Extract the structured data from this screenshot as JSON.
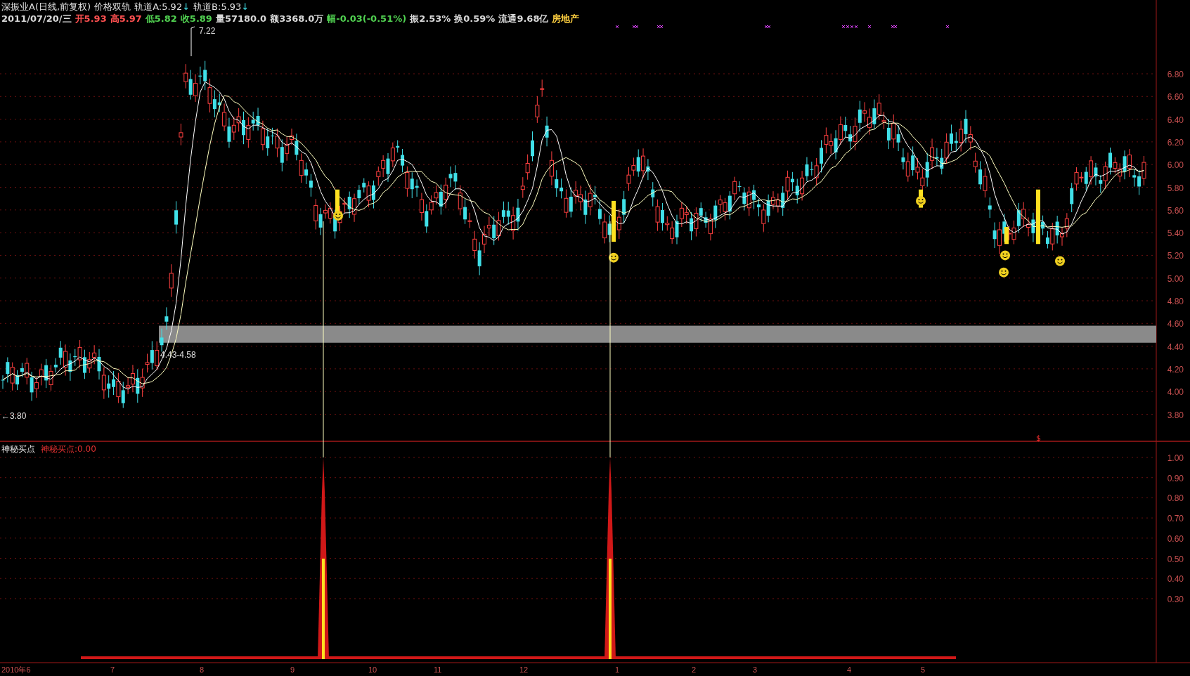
{
  "header": {
    "line1": [
      {
        "text": "深振业A(日线,前复权)",
        "color": "#e0e0e0"
      },
      {
        "text": "价格双轨",
        "color": "#e0e0e0"
      },
      {
        "text": "轨道A:5.92",
        "color": "#e0e0e0",
        "arrow": "↓"
      },
      {
        "text": "轨道B:5.93",
        "color": "#e0e0e0",
        "arrow": "↓"
      }
    ],
    "line2": [
      {
        "text": "2011/07/20/三",
        "color": "#d8d8d8"
      },
      {
        "text": "开5.93",
        "color": "#ff5050"
      },
      {
        "text": "高5.97",
        "color": "#ff5050"
      },
      {
        "text": "低5.82",
        "color": "#50d050"
      },
      {
        "text": "收5.89",
        "color": "#50d050"
      },
      {
        "text": "量57180.0",
        "color": "#d8d8d8"
      },
      {
        "text": "额3368.0万",
        "color": "#d8d8d8"
      },
      {
        "text": "幅-0.03(-0.51%)",
        "color": "#50d050"
      },
      {
        "text": "振2.53%",
        "color": "#d8d8d8"
      },
      {
        "text": "换0.59%",
        "color": "#d8d8d8"
      },
      {
        "text": "流通9.68亿",
        "color": "#d8d8d8"
      },
      {
        "text": "房地产",
        "color": "#ffd040"
      }
    ]
  },
  "price_panel": {
    "annotations": {
      "high": "7.22",
      "low": "←3.80",
      "band": "4.43-4.58"
    },
    "marker": "$",
    "axis": [
      "6.80",
      "6.60",
      "6.40",
      "6.20",
      "6.00",
      "5.80",
      "5.60",
      "5.40",
      "5.20",
      "5.00",
      "4.80",
      "4.60",
      "4.40",
      "4.20",
      "4.00",
      "3.80"
    ]
  },
  "indicator_panel": {
    "name": "神秘买点",
    "reading": "神秘买点:0.00",
    "axis": [
      "1.00",
      "0.90",
      "0.80",
      "0.70",
      "0.60",
      "0.50",
      "0.40",
      "0.30"
    ]
  },
  "time_axis": [
    "2010年6",
    "7",
    "8",
    "9",
    "10",
    "11",
    "12",
    "1",
    "2",
    "3",
    "4",
    "5"
  ]
}
